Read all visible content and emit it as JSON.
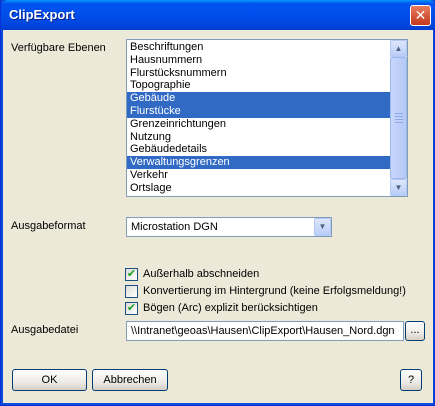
{
  "window": {
    "title": "ClipExport",
    "close_glyph": "✕"
  },
  "layers": {
    "label": "Verfügbare Ebenen",
    "items": [
      {
        "label": "Beschriftungen",
        "selected": false
      },
      {
        "label": "Hausnummern",
        "selected": false
      },
      {
        "label": "Flurstücksnummern",
        "selected": false
      },
      {
        "label": "Topographie",
        "selected": false
      },
      {
        "label": "Gebäude",
        "selected": true
      },
      {
        "label": "Flurstücke",
        "selected": true
      },
      {
        "label": "Grenzeinrichtungen",
        "selected": false
      },
      {
        "label": "Nutzung",
        "selected": false
      },
      {
        "label": "Gebäudedetails",
        "selected": false
      },
      {
        "label": "Verwaltungsgrenzen",
        "selected": true
      },
      {
        "label": "Verkehr",
        "selected": false
      },
      {
        "label": "Ortslage",
        "selected": false
      }
    ],
    "scroll_up_glyph": "▲",
    "scroll_down_glyph": "▼"
  },
  "format": {
    "label": "Ausgabeformat",
    "value": "Microstation DGN",
    "dropdown_glyph": "▼"
  },
  "options": {
    "clip_outside": {
      "label": "Außerhalb abschneiden",
      "checked": true
    },
    "background": {
      "label": "Konvertierung im Hintergrund (keine Erfolgsmeldung!)",
      "checked": false
    },
    "arcs": {
      "label": "Bögen (Arc) explizit berücksichtigen",
      "checked": true
    },
    "check_glyph": "✔"
  },
  "output": {
    "label": "Ausgabedatei",
    "value": "\\\\Intranet\\geoas\\Hausen\\ClipExport\\Hausen_Nord.dgn",
    "browse_label": "..."
  },
  "buttons": {
    "ok": "OK",
    "cancel": "Abbrechen",
    "help": "?"
  },
  "colors": {
    "selection": "#316ac5",
    "titlebar": "#0053ee"
  }
}
